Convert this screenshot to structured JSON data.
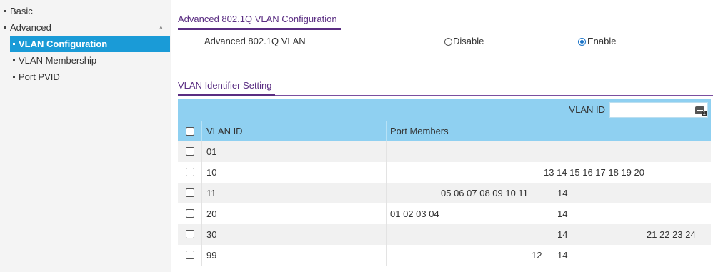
{
  "sidebar": {
    "items": [
      {
        "label": "Basic"
      },
      {
        "label": "Advanced"
      },
      {
        "label": "VLAN Configuration"
      },
      {
        "label": "VLAN Membership"
      },
      {
        "label": "Port PVID"
      }
    ],
    "active_item": "VLAN Configuration",
    "accent": "#1a9bd7"
  },
  "advanced_section": {
    "title": "Advanced 802.1Q VLAN Configuration",
    "field_label": "Advanced 802.1Q VLAN",
    "options": [
      {
        "label": "Disable",
        "selected": false
      },
      {
        "label": "Enable",
        "selected": true
      }
    ]
  },
  "identifier_section": {
    "title": "VLAN Identifier Setting"
  },
  "table": {
    "filter_label": "VLAN ID",
    "filter_value": "",
    "columns": [
      "VLAN ID",
      "Port Members"
    ],
    "rows": [
      {
        "vlan_id": "01",
        "members": []
      },
      {
        "vlan_id": "10",
        "members": [
          "13 14 15 16 17 18 19 20"
        ]
      },
      {
        "vlan_id": "11",
        "members": [
          "05 06 07 08 09 10 11",
          "14"
        ]
      },
      {
        "vlan_id": "20",
        "members": [
          "01 02 03 04",
          "14"
        ]
      },
      {
        "vlan_id": "30",
        "members": [
          "14",
          "21 22 23 24"
        ]
      },
      {
        "vlan_id": "99",
        "members": [
          "12",
          "14"
        ]
      }
    ],
    "header_color": "#8fd0f1"
  },
  "colors": {
    "heading_purple": "#5a2d82",
    "radio_selected": "#1a73c7"
  }
}
